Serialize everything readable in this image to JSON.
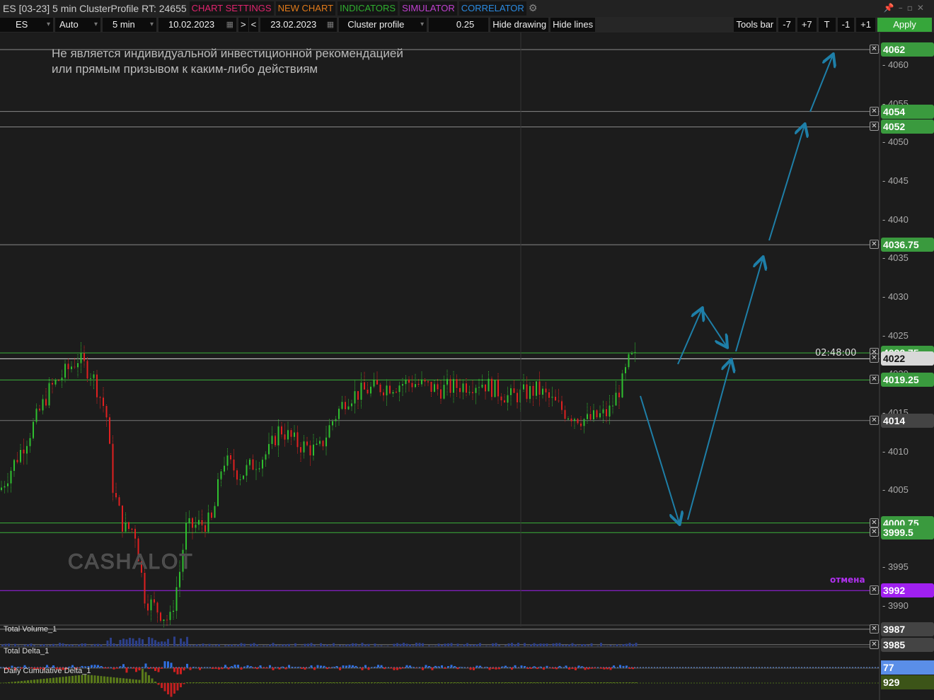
{
  "title": "ES [03-23] 5 min ClusterProfile RT: 24655",
  "menus": [
    {
      "label": "CHART SETTINGS",
      "color": "#e0246e"
    },
    {
      "label": "NEW CHART",
      "color": "#e07a1a"
    },
    {
      "label": "INDICATORS",
      "color": "#2fae2f"
    },
    {
      "label": "SIMULATOR",
      "color": "#c040d0"
    },
    {
      "label": "CORRELATOR",
      "color": "#2a8ae0"
    }
  ],
  "toolbar": {
    "symbol": "ES",
    "mode": "Auto",
    "timeframe": "5 min",
    "date_from": "10.02.2023",
    "next": ">",
    "prev": "<",
    "date_to": "23.02.2023",
    "chart_type": "Cluster profile",
    "tick_size": "0.25",
    "hide_drawing": "Hide drawing",
    "hide_lines": "Hide lines",
    "tools_bar": "Tools bar",
    "m7": "-7",
    "p7": "+7",
    "t": "T",
    "m1": "-1",
    "p1": "+1",
    "apply": "Apply"
  },
  "disclaimer": [
    "Не является индивидуальной инвестиционной рекомендацией",
    "или прямым призывом к каким-либо действиям"
  ],
  "watermark": "CASHALOT",
  "time_label": "02:48:00",
  "cancel_label": "отмена",
  "axis_ticks": [
    "4060",
    "4055",
    "4050",
    "4045",
    "4040",
    "4035",
    "4030",
    "4025",
    "4020",
    "4015",
    "4010",
    "4005",
    "3995",
    "3990"
  ],
  "levels": [
    {
      "price": 4062,
      "label": "4062",
      "color": "#3a9a3e",
      "line": "#888"
    },
    {
      "price": 4054,
      "label": "4054",
      "color": "#3a9a3e",
      "line": "#888"
    },
    {
      "price": 4052,
      "label": "4052",
      "color": "#3a9a3e",
      "line": "#888"
    },
    {
      "price": 4036.75,
      "label": "4036.75",
      "color": "#3a9a3e",
      "line": "#888"
    },
    {
      "price": 4022.75,
      "label": "4022.75",
      "color": "#3a9a3e",
      "line": "#3ab03a"
    },
    {
      "price": 4022,
      "label": "4022",
      "color": "#d8d8d8",
      "line": "#ddd"
    },
    {
      "price": 4019.25,
      "label": "4019.25",
      "color": "#3a9a3e",
      "line": "#3ab03a"
    },
    {
      "price": 4014,
      "label": "4014",
      "color": "#444",
      "line": "#777"
    },
    {
      "price": 4000.75,
      "label": "4000.75",
      "color": "#3a9a3e",
      "line": "#3ab03a"
    },
    {
      "price": 3999.5,
      "label": "3999.5",
      "color": "#3a9a3e",
      "line": "#3ab03a"
    },
    {
      "price": 3992,
      "label": "3992",
      "color": "#a020f0",
      "line": "#a020f0"
    },
    {
      "price": 3987,
      "label": "3987",
      "color": "#444",
      "line": "#888"
    },
    {
      "price": 3985,
      "label": "3985",
      "color": "#444",
      "line": "#777"
    }
  ],
  "panels": {
    "volume": "Total Volume_1",
    "delta": "Total Delta_1",
    "cum_delta": "Daily Cumulative Delta_1",
    "delta_value": "77",
    "cum_delta_value": "929"
  },
  "price_path": [
    [
      0,
      4005
    ],
    [
      40,
      4012
    ],
    [
      70,
      4018
    ],
    [
      110,
      4022
    ],
    [
      130,
      4020
    ],
    [
      150,
      4015
    ],
    [
      160,
      4005
    ],
    [
      175,
      4000
    ],
    [
      190,
      4000
    ],
    [
      205,
      3991
    ],
    [
      240,
      3988
    ],
    [
      255,
      3995
    ],
    [
      262,
      4000
    ],
    [
      300,
      4001
    ],
    [
      315,
      4009
    ],
    [
      340,
      4007
    ],
    [
      380,
      4010
    ],
    [
      395,
      4013
    ],
    [
      420,
      4011
    ],
    [
      450,
      4010
    ],
    [
      470,
      4014
    ],
    [
      490,
      4017
    ],
    [
      520,
      4018
    ],
    [
      580,
      4019
    ],
    [
      620,
      4018
    ],
    [
      680,
      4019
    ],
    [
      720,
      4017
    ],
    [
      760,
      4018
    ],
    [
      800,
      4015
    ],
    [
      830,
      4014
    ],
    [
      860,
      4015
    ],
    [
      880,
      4019
    ],
    [
      890,
      4022
    ],
    [
      900,
      4022
    ]
  ],
  "colors": {
    "up": "#2fbf2f",
    "down": "#e02020",
    "arrow": "#1e7fa8"
  }
}
